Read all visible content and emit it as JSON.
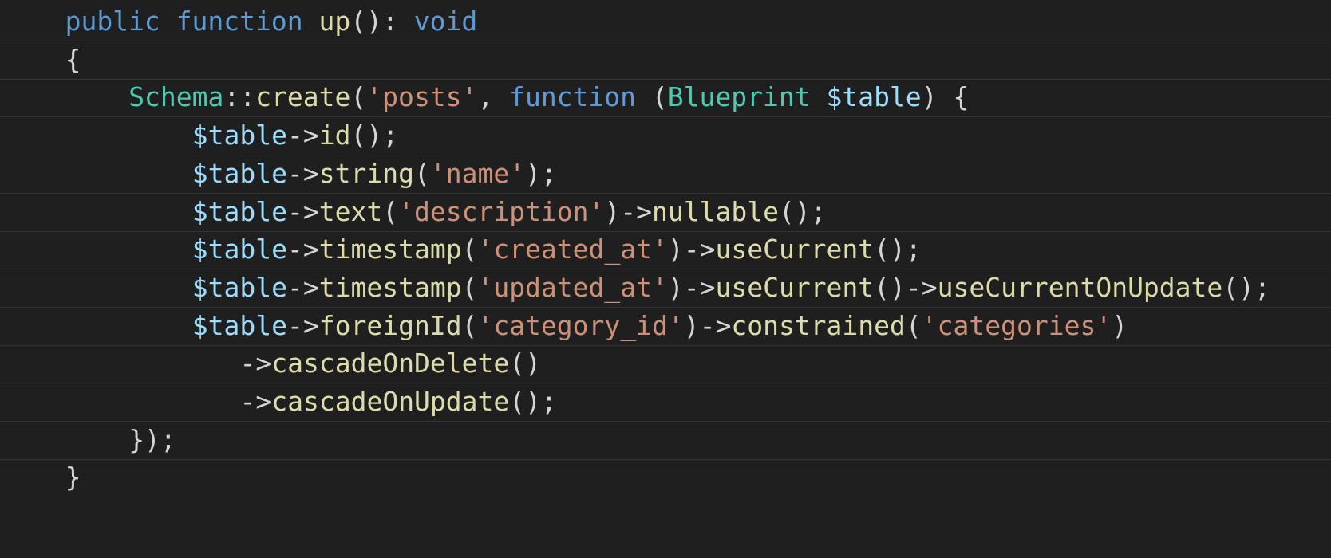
{
  "editor": {
    "lines": [
      {
        "indent": 4,
        "tokens": [
          {
            "t": "public",
            "k": "kw"
          },
          {
            "t": " ",
            "k": "pn"
          },
          {
            "t": "function",
            "k": "kw"
          },
          {
            "t": " ",
            "k": "pn"
          },
          {
            "t": "up",
            "k": "fn"
          },
          {
            "t": "(): ",
            "k": "pn"
          },
          {
            "t": "void",
            "k": "kw"
          }
        ]
      },
      {
        "indent": 4,
        "tokens": [
          {
            "t": "{",
            "k": "pn"
          }
        ]
      },
      {
        "indent": 8,
        "tokens": [
          {
            "t": "Schema",
            "k": "cls"
          },
          {
            "t": "::",
            "k": "op"
          },
          {
            "t": "create",
            "k": "fn"
          },
          {
            "t": "(",
            "k": "pn"
          },
          {
            "t": "'posts'",
            "k": "str"
          },
          {
            "t": ", ",
            "k": "pn"
          },
          {
            "t": "function",
            "k": "kw"
          },
          {
            "t": " (",
            "k": "pn"
          },
          {
            "t": "Blueprint",
            "k": "cls"
          },
          {
            "t": " ",
            "k": "pn"
          },
          {
            "t": "$table",
            "k": "var"
          },
          {
            "t": ") {",
            "k": "pn"
          }
        ]
      },
      {
        "indent": 12,
        "tokens": [
          {
            "t": "$table",
            "k": "var"
          },
          {
            "t": "->",
            "k": "op"
          },
          {
            "t": "id",
            "k": "fn"
          },
          {
            "t": "();",
            "k": "pn"
          }
        ]
      },
      {
        "indent": 12,
        "tokens": [
          {
            "t": "$table",
            "k": "var"
          },
          {
            "t": "->",
            "k": "op"
          },
          {
            "t": "string",
            "k": "fn"
          },
          {
            "t": "(",
            "k": "pn"
          },
          {
            "t": "'name'",
            "k": "str"
          },
          {
            "t": ");",
            "k": "pn"
          }
        ]
      },
      {
        "indent": 12,
        "tokens": [
          {
            "t": "$table",
            "k": "var"
          },
          {
            "t": "->",
            "k": "op"
          },
          {
            "t": "text",
            "k": "fn"
          },
          {
            "t": "(",
            "k": "pn"
          },
          {
            "t": "'description'",
            "k": "str"
          },
          {
            "t": ")->",
            "k": "pn"
          },
          {
            "t": "nullable",
            "k": "fn"
          },
          {
            "t": "();",
            "k": "pn"
          }
        ]
      },
      {
        "indent": 12,
        "tokens": [
          {
            "t": "$table",
            "k": "var"
          },
          {
            "t": "->",
            "k": "op"
          },
          {
            "t": "timestamp",
            "k": "fn"
          },
          {
            "t": "(",
            "k": "pn"
          },
          {
            "t": "'created_at'",
            "k": "str"
          },
          {
            "t": ")->",
            "k": "pn"
          },
          {
            "t": "useCurrent",
            "k": "fn"
          },
          {
            "t": "();",
            "k": "pn"
          }
        ]
      },
      {
        "indent": 12,
        "tokens": [
          {
            "t": "$table",
            "k": "var"
          },
          {
            "t": "->",
            "k": "op"
          },
          {
            "t": "timestamp",
            "k": "fn"
          },
          {
            "t": "(",
            "k": "pn"
          },
          {
            "t": "'updated_at'",
            "k": "str"
          },
          {
            "t": ")->",
            "k": "pn"
          },
          {
            "t": "useCurrent",
            "k": "fn"
          },
          {
            "t": "()->",
            "k": "pn"
          },
          {
            "t": "useCurrentOnUpdate",
            "k": "fn"
          },
          {
            "t": "();",
            "k": "pn"
          }
        ]
      },
      {
        "indent": 12,
        "tokens": [
          {
            "t": "$table",
            "k": "var"
          },
          {
            "t": "->",
            "k": "op"
          },
          {
            "t": "foreignId",
            "k": "fn"
          },
          {
            "t": "(",
            "k": "pn"
          },
          {
            "t": "'category_id'",
            "k": "str"
          },
          {
            "t": ")->",
            "k": "pn"
          },
          {
            "t": "constrained",
            "k": "fn"
          },
          {
            "t": "(",
            "k": "pn"
          },
          {
            "t": "'categories'",
            "k": "str"
          },
          {
            "t": ")",
            "k": "pn"
          }
        ]
      },
      {
        "indent": 15,
        "tokens": [
          {
            "t": "->",
            "k": "op"
          },
          {
            "t": "cascadeOnDelete",
            "k": "fn"
          },
          {
            "t": "()",
            "k": "pn"
          }
        ]
      },
      {
        "indent": 15,
        "tokens": [
          {
            "t": "->",
            "k": "op"
          },
          {
            "t": "cascadeOnUpdate",
            "k": "fn"
          },
          {
            "t": "();",
            "k": "pn"
          }
        ]
      },
      {
        "indent": 8,
        "tokens": [
          {
            "t": "});",
            "k": "pn"
          }
        ]
      },
      {
        "indent": 4,
        "tokens": [
          {
            "t": "}",
            "k": "pn"
          }
        ]
      }
    ]
  }
}
